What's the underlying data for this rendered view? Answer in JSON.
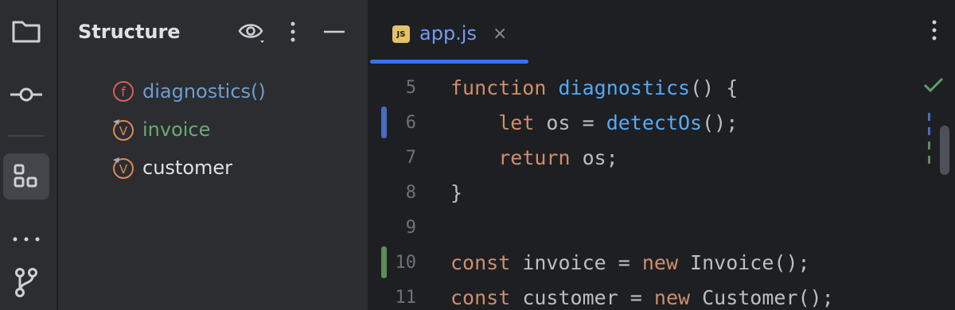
{
  "activity_bar": {
    "icons": [
      "folder-icon",
      "commit-icon",
      "structure-icon",
      "more-icon",
      "git-branch-icon"
    ]
  },
  "structure_panel": {
    "title": "Structure",
    "items": [
      {
        "name": "diagnostics()",
        "kind": "function",
        "badge": "f",
        "color": "#6f9ccf"
      },
      {
        "name": "invoice",
        "kind": "variable",
        "badge": "V",
        "color": "#6aab73"
      },
      {
        "name": "customer",
        "kind": "variable",
        "badge": "V",
        "color": "#dfe1e5"
      }
    ]
  },
  "editor": {
    "tab": {
      "icon_label": "JS",
      "filename": "app.js",
      "close": "×"
    },
    "line_numbers": [
      "5",
      "6",
      "7",
      "8",
      "9",
      "10",
      "11"
    ],
    "colors": {
      "keyword": "#cf8e6d",
      "function": "#56a8f5",
      "text": "#bcbec4",
      "accent": "#3574f0",
      "added": "#5f8c58",
      "modified": "#4a6bc0"
    }
  }
}
